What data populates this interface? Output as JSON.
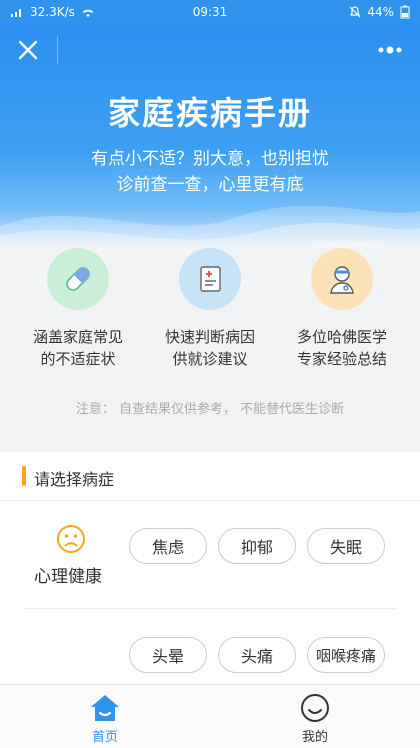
{
  "status_bar": {
    "net_speed": "32.3K/s",
    "time": "09:31",
    "battery": "44%"
  },
  "hero": {
    "title": "家庭疾病手册",
    "subtitle_line1": "有点小不适？别大意，也别担忧",
    "subtitle_line2": "诊前查一查，心里更有底"
  },
  "features": [
    {
      "icon": "capsule-icon",
      "line1": "涵盖家庭常见",
      "line2": "的不适症状",
      "color": "#c9efd9"
    },
    {
      "icon": "document-icon",
      "line1": "快速判断病因",
      "line2": "供就诊建议",
      "color": "#c7e3f8"
    },
    {
      "icon": "doctor-icon",
      "line1": "多位哈佛医学",
      "line2": "专家经验总结",
      "color": "#fde2b8"
    }
  ],
  "note": "注意：  自查结果仅供参考，  不能替代医生诊断",
  "section": {
    "title": "请选择病症",
    "category": {
      "label": "心理健康",
      "icon": "sad-face-icon"
    },
    "row1": [
      "焦虑",
      "抑郁",
      "失眠"
    ],
    "row2": [
      "头晕",
      "头痛",
      "咽喉疼痛"
    ]
  },
  "tabs": [
    {
      "label": "首页",
      "icon": "home-icon",
      "active": true
    },
    {
      "label": "我的",
      "icon": "smiley-icon",
      "active": false
    }
  ],
  "colors": {
    "primary": "#2f93ee",
    "accent": "#f5a623",
    "tab_active": "#2f93ee"
  }
}
